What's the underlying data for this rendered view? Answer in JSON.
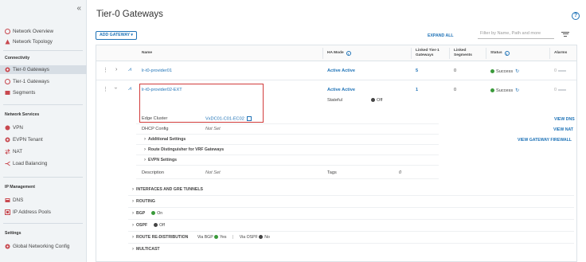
{
  "sidebar": {
    "collapse_glyph": "«",
    "top_items": [
      {
        "label": "Network Overview",
        "icon": "network-overview-icon",
        "color": "#c8484f"
      },
      {
        "label": "Network Topology",
        "icon": "network-topology-icon",
        "color": "#c8484f"
      }
    ],
    "sections": {
      "connectivity": "Connectivity",
      "network_services": "Network Services",
      "ip_management": "IP Management",
      "settings": "Settings"
    },
    "connectivity_items": [
      {
        "label": "Tier-0 Gateways",
        "icon": "tier0-gateway-icon",
        "active": true
      },
      {
        "label": "Tier-1 Gateways",
        "icon": "tier1-gateway-icon"
      },
      {
        "label": "Segments",
        "icon": "segments-icon"
      }
    ],
    "network_services_items": [
      {
        "label": "VPN",
        "icon": "vpn-icon"
      },
      {
        "label": "EVPN Tenant",
        "icon": "evpn-tenant-icon"
      },
      {
        "label": "NAT",
        "icon": "nat-icon"
      },
      {
        "label": "Load Balancing",
        "icon": "load-balancing-icon"
      }
    ],
    "ip_management_items": [
      {
        "label": "DNS",
        "icon": "dns-icon"
      },
      {
        "label": "IP Address Pools",
        "icon": "ip-address-pools-icon"
      }
    ],
    "settings_items": [
      {
        "label": "Global Networking Config",
        "icon": "global-networking-config-icon"
      }
    ]
  },
  "main": {
    "title": "Tier-0 Gateways",
    "add_gateway": "ADD GATEWAY ▾",
    "expand_all": "EXPAND ALL",
    "filter_placeholder": "Filter by Name, Path and more",
    "columns": {
      "name": "Name",
      "ha_mode": "HA Mode",
      "linked_t1": "Linked Tier-1 Gateways",
      "linked_segments": "Linked Segments",
      "status": "Status",
      "alarms": "Alarms"
    },
    "rows": [
      {
        "name": "lr-t0-provider01",
        "ha_mode": "Active Active",
        "linked_t1": "5",
        "linked_segments": "0",
        "status": "Success",
        "alarms": "0"
      },
      {
        "name": "lr-t0-provider02-EXT",
        "ha_mode": "Active Active",
        "stateful_label": "Stateful",
        "stateful_value": "Off",
        "linked_t1": "1",
        "linked_segments": "0",
        "status": "Success",
        "alarms": "0"
      }
    ],
    "details": {
      "edge_cluster_label": "Edge Cluster",
      "edge_cluster_value": "VxDC01-C01-EC02",
      "dhcp_label": "DHCP Config",
      "dhcp_value": "Not Set",
      "additional_settings": "Additional Settings",
      "route_distinguisher": "Route Distinguisher for VRF Gateways",
      "evpn_settings": "EVPN Settings",
      "description_label": "Description",
      "description_value": "Not Set",
      "tags_label": "Tags",
      "tags_value": "0",
      "view_dns": "VIEW DNS",
      "view_nat": "VIEW NAT",
      "view_gateway_firewall": "VIEW GATEWAY FIREWALL"
    },
    "sections": {
      "interfaces": "INTERFACES AND GRE TUNNELS",
      "routing": "ROUTING",
      "bgp": "BGP",
      "bgp_value": "On",
      "ospf": "OSPF",
      "ospf_value": "Off",
      "route_redistribution": "ROUTE RE-DISTRIBUTION",
      "via_bgp": "Via BGP",
      "via_bgp_value": "Yes",
      "separator": "|",
      "via_ospf": "Via OSPF",
      "via_ospf_value": "No",
      "multicast": "MULTICAST"
    }
  },
  "colors": {
    "accent": "#1f73b7",
    "success": "#3a9a3a",
    "highlight_border": "#d13b3b",
    "sidebar_bg": "#f1f4f6",
    "sidebar_active": "#d7dee5"
  }
}
